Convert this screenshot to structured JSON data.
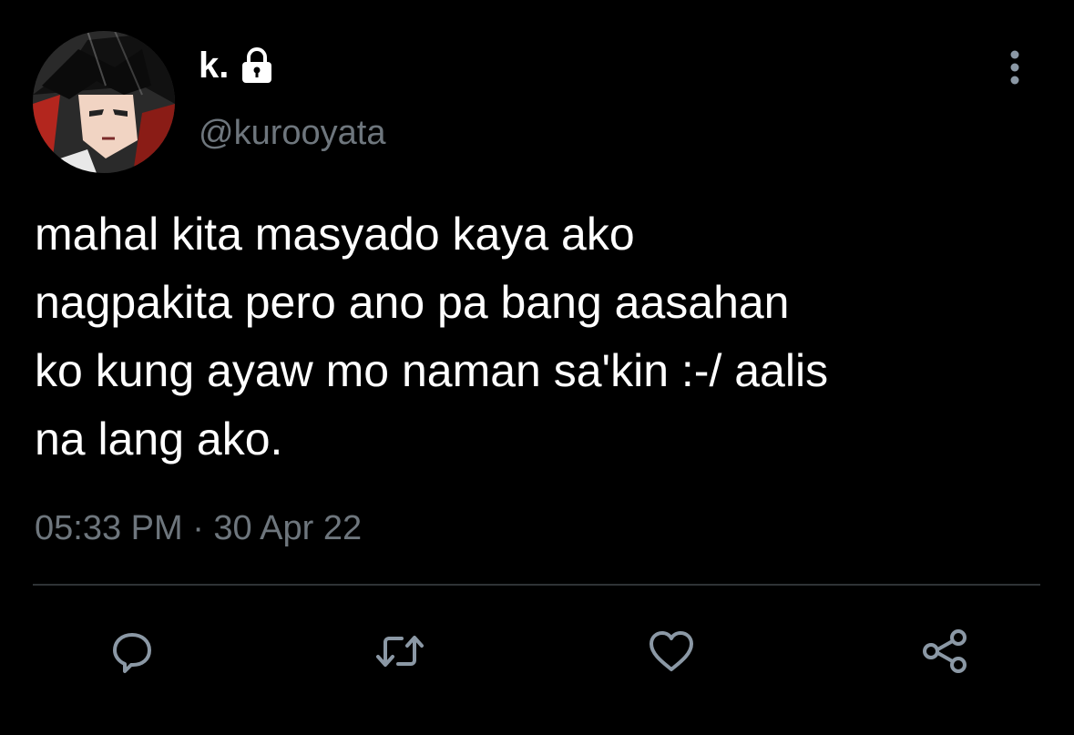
{
  "user": {
    "display_name": "k.",
    "handle": "@kurooyata",
    "protected": true,
    "avatar_icon": "anime-character-avatar"
  },
  "tweet": {
    "text": "mahal kita masyado kaya ako\nnagpakita pero ano pa bang aasahan\nko kung ayaw mo naman sa'kin :-/ aalis\nna lang ako.",
    "timestamp": "05:33 PM · 30 Apr 22"
  },
  "actions": {
    "reply_icon": "reply-icon",
    "retweet_icon": "retweet-icon",
    "like_icon": "heart-icon",
    "share_icon": "share-icon",
    "more_icon": "more-vertical-icon"
  },
  "colors": {
    "background": "#000000",
    "text_primary": "#ffffff",
    "text_secondary": "#6e767d",
    "divider": "#2f3336",
    "icon": "#8b98a5"
  }
}
